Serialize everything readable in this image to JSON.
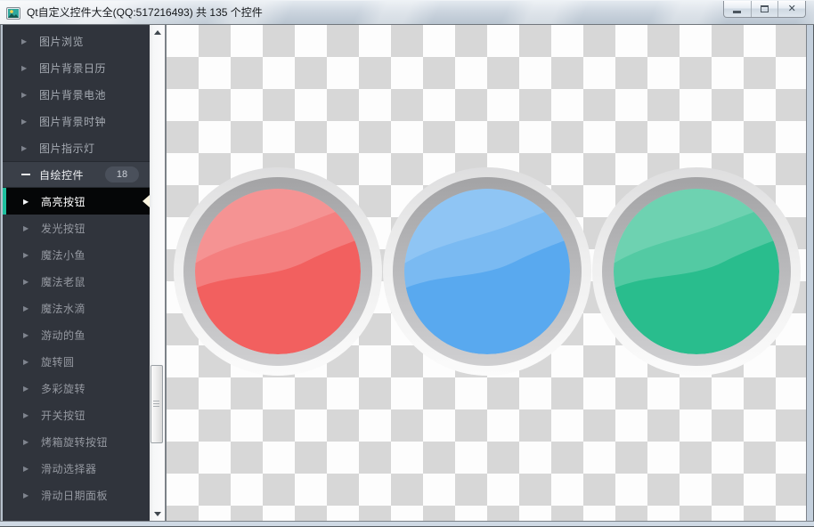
{
  "window": {
    "title": "Qt自定义控件大全(QQ:517216493) 共 135 个控件",
    "controls": [
      {
        "name": "minimize"
      },
      {
        "name": "maximize"
      },
      {
        "name": "close"
      }
    ],
    "app_icon": "picture-icon"
  },
  "sidebar": {
    "items": [
      {
        "label": "图片浏览",
        "type": "parent",
        "expanded": false
      },
      {
        "label": "图片背景日历",
        "type": "parent",
        "expanded": false
      },
      {
        "label": "图片背景电池",
        "type": "parent",
        "expanded": false
      },
      {
        "label": "图片背景时钟",
        "type": "parent",
        "expanded": false
      },
      {
        "label": "图片指示灯",
        "type": "parent",
        "expanded": false
      },
      {
        "label": "自绘控件",
        "type": "parent",
        "expanded": true,
        "badge": "18"
      },
      {
        "label": "高亮按钮",
        "type": "child",
        "selected": true
      },
      {
        "label": "发光按钮",
        "type": "child"
      },
      {
        "label": "魔法小鱼",
        "type": "child"
      },
      {
        "label": "魔法老鼠",
        "type": "child"
      },
      {
        "label": "魔法水滴",
        "type": "child"
      },
      {
        "label": "游动的鱼",
        "type": "child"
      },
      {
        "label": "旋转圆",
        "type": "child"
      },
      {
        "label": "多彩旋转",
        "type": "child"
      },
      {
        "label": "开关按钮",
        "type": "child"
      },
      {
        "label": "烤箱旋转按钮",
        "type": "child"
      },
      {
        "label": "滑动选择器",
        "type": "child"
      },
      {
        "label": "滑动日期面板",
        "type": "child"
      }
    ],
    "selected_accent": "#1ebf9e"
  },
  "content": {
    "widget": "highlight-buttons-demo",
    "buttons": [
      {
        "name": "red-highlight-button",
        "color": "#f2605f"
      },
      {
        "name": "blue-highlight-button",
        "color": "#59a9ef"
      },
      {
        "name": "green-highlight-button",
        "color": "#29bd8d"
      }
    ],
    "checker_colors": [
      "#fdfdfd",
      "#d7d7d7"
    ]
  }
}
